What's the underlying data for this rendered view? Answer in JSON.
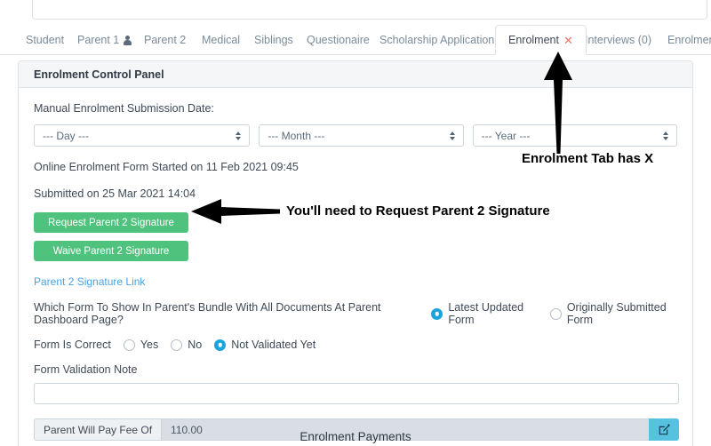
{
  "tabs": [
    {
      "label": "Student",
      "icon": null,
      "has_x": false,
      "active": false
    },
    {
      "label": "Parent 1",
      "icon": "person-icon",
      "has_x": false,
      "active": false
    },
    {
      "label": "Parent 2",
      "icon": null,
      "has_x": false,
      "active": false
    },
    {
      "label": "Medical",
      "icon": null,
      "has_x": false,
      "active": false
    },
    {
      "label": "Siblings",
      "icon": null,
      "has_x": false,
      "active": false
    },
    {
      "label": "Questionaire",
      "icon": null,
      "has_x": false,
      "active": false
    },
    {
      "label": "Scholarship Application",
      "icon": null,
      "has_x": true,
      "active": false
    },
    {
      "label": "Enrolment",
      "icon": null,
      "has_x": true,
      "active": true
    },
    {
      "label": "Interviews (0)",
      "icon": null,
      "has_x": false,
      "active": false
    },
    {
      "label": "Enrolment O",
      "icon": null,
      "has_x": false,
      "active": false
    }
  ],
  "tab_close_glyph": "✕",
  "panel": {
    "title": "Enrolment Control Panel",
    "manual_date_label": "Manual Enrolment Submission Date:",
    "day_select": "--- Day ---",
    "month_select": "--- Month ---",
    "year_select": "--- Year ---",
    "started_line": "Online Enrolment Form Started on 11 Feb 2021 09:45",
    "submitted_line": "Submitted on 25 Mar 2021 14:04",
    "request_signature_button": "Request Parent 2 Signature",
    "waive_signature_button": "Waive Parent 2 Signature",
    "signature_link": "Parent 2 Signature Link",
    "which_form_label": "Which Form To Show In Parent's Bundle With All Documents At Parent Dashboard Page?",
    "which_form_options": [
      {
        "label": "Latest Updated Form",
        "selected": true
      },
      {
        "label": "Originally Submitted Form",
        "selected": false
      }
    ],
    "form_is_correct_label": "Form Is Correct",
    "form_is_correct_options": [
      {
        "label": "Yes",
        "selected": false
      },
      {
        "label": "No",
        "selected": false
      },
      {
        "label": "Not Validated Yet",
        "selected": true
      }
    ],
    "validation_note_label": "Form Validation Note",
    "validation_note_value": "",
    "validation_note_placeholder": "",
    "fee_addon_label": "Parent Will Pay Fee Of",
    "fee_value": "110.00",
    "fee_edit_icon": "pencil-square-icon",
    "payments_title": "Enrolment Payments"
  },
  "annotations": [
    {
      "text": "Enrolment Tab has X"
    },
    {
      "text": "You'll need to Request Parent 2 Signature"
    }
  ],
  "colors": {
    "green_button": "#4fc37d",
    "radio_selected": "#1ba3dd",
    "link": "#4aa3df",
    "tab_close_x": "#e8756b",
    "fee_edit_button": "#56c2e0"
  }
}
